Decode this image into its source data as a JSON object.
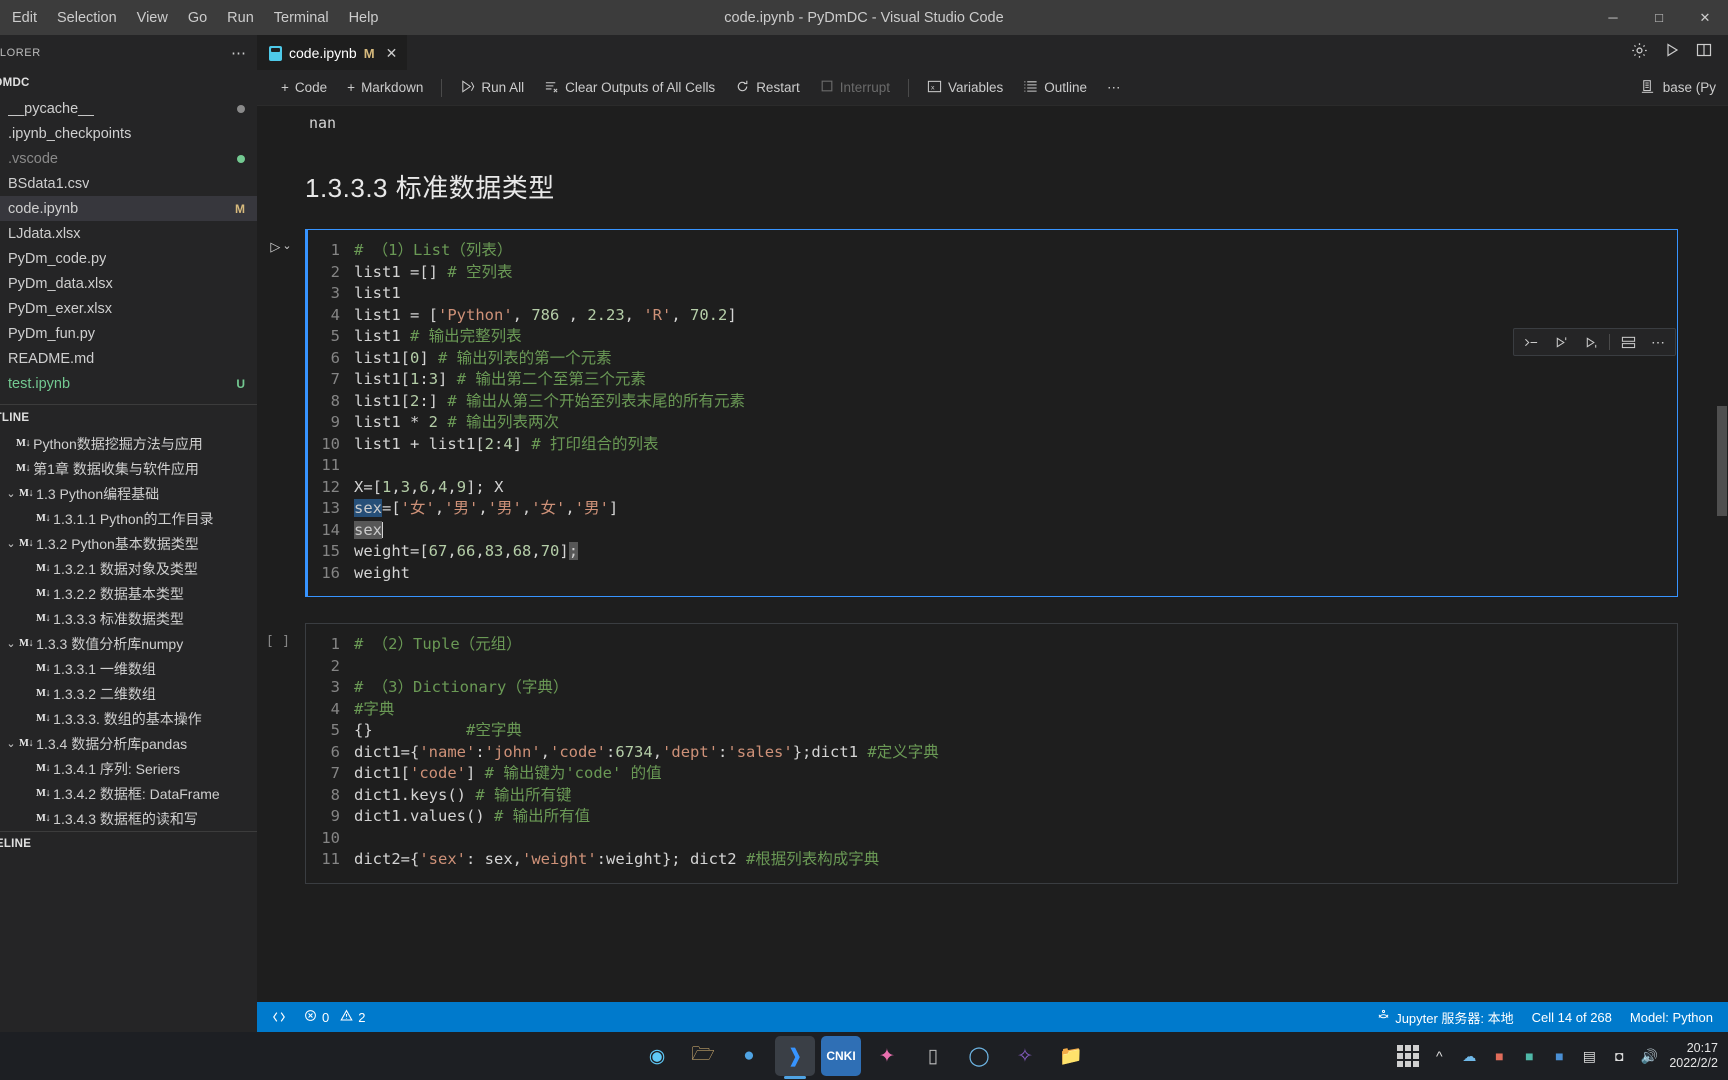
{
  "window": {
    "title": "code.ipynb - PyDmDC - Visual Studio Code",
    "menu": [
      "Edit",
      "Selection",
      "View",
      "Go",
      "Run",
      "Terminal",
      "Help"
    ],
    "controls": {
      "minimize": "─",
      "maximize": "□",
      "close": "✕"
    }
  },
  "sidebar": {
    "header_label": "XPLORER",
    "header_more": "⋯",
    "project_name": "YDMDC",
    "files": [
      {
        "name": "__pycache__",
        "badge": "",
        "badge_color": "#8a8a8a",
        "kind": "dot",
        "color": "#cfcfcf"
      },
      {
        "name": ".ipynb_checkpoints",
        "badge": "",
        "badge_color": "",
        "kind": "none",
        "color": "#cfcfcf"
      },
      {
        "name": ".vscode",
        "badge": "",
        "badge_color": "#73c991",
        "kind": "dot",
        "color": "#8a8a8a"
      },
      {
        "name": "BSdata1.csv",
        "badge": "",
        "badge_color": "",
        "kind": "none",
        "color": "#cfcfcf"
      },
      {
        "name": "code.ipynb",
        "badge": "M",
        "badge_color": "#d7ba7d",
        "kind": "text",
        "color": "#cfcfcf",
        "selected": true
      },
      {
        "name": "LJdata.xlsx",
        "badge": "",
        "badge_color": "",
        "kind": "none",
        "color": "#cfcfcf"
      },
      {
        "name": "PyDm_code.py",
        "badge": "",
        "badge_color": "",
        "kind": "none",
        "color": "#cfcfcf"
      },
      {
        "name": "PyDm_data.xlsx",
        "badge": "",
        "badge_color": "",
        "kind": "none",
        "color": "#cfcfcf"
      },
      {
        "name": "PyDm_exer.xlsx",
        "badge": "",
        "badge_color": "",
        "kind": "none",
        "color": "#cfcfcf"
      },
      {
        "name": "PyDm_fun.py",
        "badge": "",
        "badge_color": "",
        "kind": "none",
        "color": "#cfcfcf"
      },
      {
        "name": "README.md",
        "badge": "",
        "badge_color": "",
        "kind": "none",
        "color": "#cfcfcf"
      },
      {
        "name": "test.ipynb",
        "badge": "U",
        "badge_color": "#73c991",
        "kind": "text",
        "color": "#73c991"
      }
    ],
    "outline_label": "UTLINE",
    "outline": [
      {
        "chevron": "",
        "indent": 0,
        "tag": "M↓",
        "text": "Python数据挖掘方法与应用"
      },
      {
        "chevron": "",
        "indent": 0,
        "tag": "M↓",
        "text": "第1章 数据收集与软件应用"
      },
      {
        "chevron": "⌄",
        "indent": 1,
        "tag": "M↓",
        "text": "1.3 Python编程基础"
      },
      {
        "chevron": "",
        "indent": 2,
        "tag": "M↓",
        "text": "1.3.1.1 Python的工作目录"
      },
      {
        "chevron": "⌄",
        "indent": 1,
        "tag": "M↓",
        "text": "1.3.2 Python基本数据类型"
      },
      {
        "chevron": "",
        "indent": 2,
        "tag": "M↓",
        "text": "1.3.2.1 数据对象及类型"
      },
      {
        "chevron": "",
        "indent": 2,
        "tag": "M↓",
        "text": "1.3.2.2 数据基本类型"
      },
      {
        "chevron": "",
        "indent": 2,
        "tag": "M↓",
        "text": "1.3.3.3 标准数据类型"
      },
      {
        "chevron": "⌄",
        "indent": 1,
        "tag": "M↓",
        "text": "1.3.3 数值分析库numpy"
      },
      {
        "chevron": "",
        "indent": 2,
        "tag": "M↓",
        "text": "1.3.3.1 一维数组"
      },
      {
        "chevron": "",
        "indent": 2,
        "tag": "M↓",
        "text": "1.3.3.2 二维数组"
      },
      {
        "chevron": "",
        "indent": 2,
        "tag": "M↓",
        "text": "1.3.3.3. 数组的基本操作"
      },
      {
        "chevron": "⌄",
        "indent": 1,
        "tag": "M↓",
        "text": "1.3.4 数据分析库pandas"
      },
      {
        "chevron": "",
        "indent": 2,
        "tag": "M↓",
        "text": "1.3.4.1 序列: Seriers"
      },
      {
        "chevron": "",
        "indent": 2,
        "tag": "M↓",
        "text": "1.3.4.2 数据框: DataFrame"
      },
      {
        "chevron": "",
        "indent": 2,
        "tag": "M↓",
        "text": "1.3.4.3 数据框的读和写"
      }
    ],
    "timeline_label": "MELINE"
  },
  "tab": {
    "filename": "code.ipynb",
    "modified_badge": "M",
    "close": "✕"
  },
  "toolbar": {
    "code_label": "Code",
    "markdown_label": "Markdown",
    "run_all_label": "Run All",
    "clear_outputs_label": "Clear Outputs of All Cells",
    "restart_label": "Restart",
    "interrupt_label": "Interrupt",
    "variables_label": "Variables",
    "outline_label": "Outline",
    "more_label": "⋯",
    "kernel_label": "base (Py"
  },
  "cell_toolbar": {
    "buttons": [
      "run-by-line-icon",
      "run-above-icon",
      "run-below-icon",
      "split-cell-icon",
      "more-icon"
    ]
  },
  "notebook": {
    "previous_output": "nan",
    "markdown_heading": "1.3.3.3 标准数据类型",
    "cell1": {
      "execution_label": "",
      "lines": [
        {
          "n": "1",
          "segments": [
            {
              "t": "# （1）List（列表）",
              "c": "comment"
            }
          ]
        },
        {
          "n": "2",
          "segments": [
            {
              "t": "list1 =[] ",
              "c": "plain"
            },
            {
              "t": "# 空列表",
              "c": "comment"
            }
          ]
        },
        {
          "n": "3",
          "segments": [
            {
              "t": "list1",
              "c": "plain"
            }
          ]
        },
        {
          "n": "4",
          "segments": [
            {
              "t": "list1 = [",
              "c": "plain"
            },
            {
              "t": "'Python'",
              "c": "str"
            },
            {
              "t": ", ",
              "c": "plain"
            },
            {
              "t": "786",
              "c": "num"
            },
            {
              "t": " , ",
              "c": "plain"
            },
            {
              "t": "2.23",
              "c": "num"
            },
            {
              "t": ", ",
              "c": "plain"
            },
            {
              "t": "'R'",
              "c": "str"
            },
            {
              "t": ", ",
              "c": "plain"
            },
            {
              "t": "70.2",
              "c": "num"
            },
            {
              "t": "]",
              "c": "plain"
            }
          ]
        },
        {
          "n": "5",
          "segments": [
            {
              "t": "list1 ",
              "c": "plain"
            },
            {
              "t": "# 输出完整列表",
              "c": "comment"
            }
          ]
        },
        {
          "n": "6",
          "segments": [
            {
              "t": "list1[",
              "c": "plain"
            },
            {
              "t": "0",
              "c": "num"
            },
            {
              "t": "] ",
              "c": "plain"
            },
            {
              "t": "# 输出列表的第一个元素",
              "c": "comment"
            }
          ]
        },
        {
          "n": "7",
          "segments": [
            {
              "t": "list1[",
              "c": "plain"
            },
            {
              "t": "1",
              "c": "num"
            },
            {
              "t": ":",
              "c": "plain"
            },
            {
              "t": "3",
              "c": "num"
            },
            {
              "t": "] ",
              "c": "plain"
            },
            {
              "t": "# 输出第二个至第三个元素",
              "c": "comment"
            }
          ]
        },
        {
          "n": "8",
          "segments": [
            {
              "t": "list1[",
              "c": "plain"
            },
            {
              "t": "2",
              "c": "num"
            },
            {
              "t": ":] ",
              "c": "plain"
            },
            {
              "t": "# 输出从第三个开始至列表末尾的所有元素",
              "c": "comment"
            }
          ]
        },
        {
          "n": "9",
          "segments": [
            {
              "t": "list1 * ",
              "c": "plain"
            },
            {
              "t": "2",
              "c": "num"
            },
            {
              "t": " ",
              "c": "plain"
            },
            {
              "t": "# 输出列表两次",
              "c": "comment"
            }
          ]
        },
        {
          "n": "10",
          "segments": [
            {
              "t": "list1 + list1[",
              "c": "plain"
            },
            {
              "t": "2",
              "c": "num"
            },
            {
              "t": ":",
              "c": "plain"
            },
            {
              "t": "4",
              "c": "num"
            },
            {
              "t": "] ",
              "c": "plain"
            },
            {
              "t": "# 打印组合的列表",
              "c": "comment"
            }
          ]
        },
        {
          "n": "11",
          "segments": [
            {
              "t": "",
              "c": "plain"
            }
          ]
        },
        {
          "n": "12",
          "segments": [
            {
              "t": "X=[",
              "c": "plain"
            },
            {
              "t": "1",
              "c": "num"
            },
            {
              "t": ",",
              "c": "plain"
            },
            {
              "t": "3",
              "c": "num"
            },
            {
              "t": ",",
              "c": "plain"
            },
            {
              "t": "6",
              "c": "num"
            },
            {
              "t": ",",
              "c": "plain"
            },
            {
              "t": "4",
              "c": "num"
            },
            {
              "t": ",",
              "c": "plain"
            },
            {
              "t": "9",
              "c": "num"
            },
            {
              "t": "]; X",
              "c": "plain"
            }
          ]
        },
        {
          "n": "13",
          "segments": [
            {
              "t": "sex",
              "c": "sel"
            },
            {
              "t": "=[",
              "c": "plain"
            },
            {
              "t": "'女'",
              "c": "str"
            },
            {
              "t": ",",
              "c": "plain"
            },
            {
              "t": "'男'",
              "c": "str"
            },
            {
              "t": ",",
              "c": "plain"
            },
            {
              "t": "'男'",
              "c": "str"
            },
            {
              "t": ",",
              "c": "plain"
            },
            {
              "t": "'女'",
              "c": "str"
            },
            {
              "t": ",",
              "c": "plain"
            },
            {
              "t": "'男'",
              "c": "str"
            },
            {
              "t": "]",
              "c": "plain"
            }
          ]
        },
        {
          "n": "14",
          "segments": [
            {
              "t": "sex",
              "c": "wordhl"
            },
            {
              "t": "▏",
              "c": "cursor"
            }
          ]
        },
        {
          "n": "15",
          "segments": [
            {
              "t": "weight=[",
              "c": "plain"
            },
            {
              "t": "67",
              "c": "num"
            },
            {
              "t": ",",
              "c": "plain"
            },
            {
              "t": "66",
              "c": "num"
            },
            {
              "t": ",",
              "c": "plain"
            },
            {
              "t": "83",
              "c": "num"
            },
            {
              "t": ",",
              "c": "plain"
            },
            {
              "t": "68",
              "c": "num"
            },
            {
              "t": ",",
              "c": "plain"
            },
            {
              "t": "70",
              "c": "num"
            },
            {
              "t": "]",
              "c": "plain"
            },
            {
              "t": ";",
              "c": "wordhl"
            }
          ]
        },
        {
          "n": "16",
          "segments": [
            {
              "t": "weight",
              "c": "plain"
            }
          ]
        }
      ]
    },
    "cell2": {
      "execution_label": "[ ]",
      "lines": [
        {
          "n": "1",
          "segments": [
            {
              "t": "# （2）Tuple（元组）",
              "c": "comment"
            }
          ]
        },
        {
          "n": "2",
          "segments": [
            {
              "t": "",
              "c": "plain"
            }
          ]
        },
        {
          "n": "3",
          "segments": [
            {
              "t": "# （3）Dictionary（字典）",
              "c": "comment"
            }
          ]
        },
        {
          "n": "4",
          "segments": [
            {
              "t": "#字典",
              "c": "comment"
            }
          ]
        },
        {
          "n": "5",
          "segments": [
            {
              "t": "{}",
              "c": "plain"
            },
            {
              "t": "          ",
              "c": "plain"
            },
            {
              "t": "#空字典",
              "c": "comment"
            }
          ]
        },
        {
          "n": "6",
          "segments": [
            {
              "t": "dict1={",
              "c": "plain"
            },
            {
              "t": "'name'",
              "c": "str"
            },
            {
              "t": ":",
              "c": "plain"
            },
            {
              "t": "'john'",
              "c": "str"
            },
            {
              "t": ",",
              "c": "plain"
            },
            {
              "t": "'code'",
              "c": "str"
            },
            {
              "t": ":",
              "c": "plain"
            },
            {
              "t": "6734",
              "c": "num"
            },
            {
              "t": ",",
              "c": "plain"
            },
            {
              "t": "'dept'",
              "c": "str"
            },
            {
              "t": ":",
              "c": "plain"
            },
            {
              "t": "'sales'",
              "c": "str"
            },
            {
              "t": "};dict1 ",
              "c": "plain"
            },
            {
              "t": "#定义字典",
              "c": "comment"
            }
          ]
        },
        {
          "n": "7",
          "segments": [
            {
              "t": "dict1[",
              "c": "plain"
            },
            {
              "t": "'code'",
              "c": "str"
            },
            {
              "t": "] ",
              "c": "plain"
            },
            {
              "t": "# 输出键为'code' 的值",
              "c": "comment"
            }
          ]
        },
        {
          "n": "8",
          "segments": [
            {
              "t": "dict1.keys() ",
              "c": "plain"
            },
            {
              "t": "# 输出所有键",
              "c": "comment"
            }
          ]
        },
        {
          "n": "9",
          "segments": [
            {
              "t": "dict1.values() ",
              "c": "plain"
            },
            {
              "t": "# 输出所有值",
              "c": "comment"
            }
          ]
        },
        {
          "n": "10",
          "segments": [
            {
              "t": "",
              "c": "plain"
            }
          ]
        },
        {
          "n": "11",
          "segments": [
            {
              "t": "dict2={",
              "c": "plain"
            },
            {
              "t": "'sex'",
              "c": "str"
            },
            {
              "t": ": sex,",
              "c": "plain"
            },
            {
              "t": "'weight'",
              "c": "str"
            },
            {
              "t": ":weight}; dict2 ",
              "c": "plain"
            },
            {
              "t": "#根据列表构成字典",
              "c": "comment"
            }
          ]
        }
      ]
    }
  },
  "statusbar": {
    "errors": "0",
    "warnings": "2",
    "jupyter_server": "Jupyter 服务器: 本地",
    "cell_position": "Cell 14 of 268",
    "model": "Model: Python"
  },
  "taskbar": {
    "time": "20:17",
    "date": "2022/2/2",
    "apps": [
      "edge-dev-icon",
      "explorer-icon",
      "chrome-icon",
      "vscode-icon",
      "cnki-icon",
      "app-pink-icon",
      "terminal-icon",
      "browser-blue-icon",
      "foxit-icon",
      "files-icon"
    ],
    "tray": [
      "show-hidden-icon",
      "onedrive-icon",
      "app-red-icon",
      "app-teal-icon",
      "app-blue-icon",
      "battery-icon",
      "wifi-icon",
      "volume-icon"
    ]
  }
}
